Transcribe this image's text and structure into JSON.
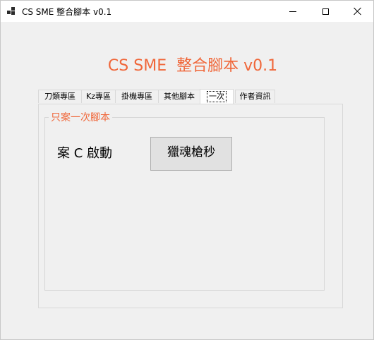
{
  "window": {
    "title": "CS SME 整合腳本 v0.1",
    "icon": "app-window-icon"
  },
  "header": {
    "title": "CS SME  整合腳本 v0.1",
    "accent_color": "#f0673a"
  },
  "tabs": [
    {
      "label": "刀類專區",
      "active": false
    },
    {
      "label": "Kz專區",
      "active": false
    },
    {
      "label": "掛機專區",
      "active": false
    },
    {
      "label": "其他腳本",
      "active": false
    },
    {
      "label": "一次",
      "active": true
    },
    {
      "label": "作者資訊",
      "active": false
    }
  ],
  "group": {
    "title": "只案一次腳本",
    "hotkey_label": "案 C 啟動",
    "action_button": "獵魂槍秒"
  }
}
